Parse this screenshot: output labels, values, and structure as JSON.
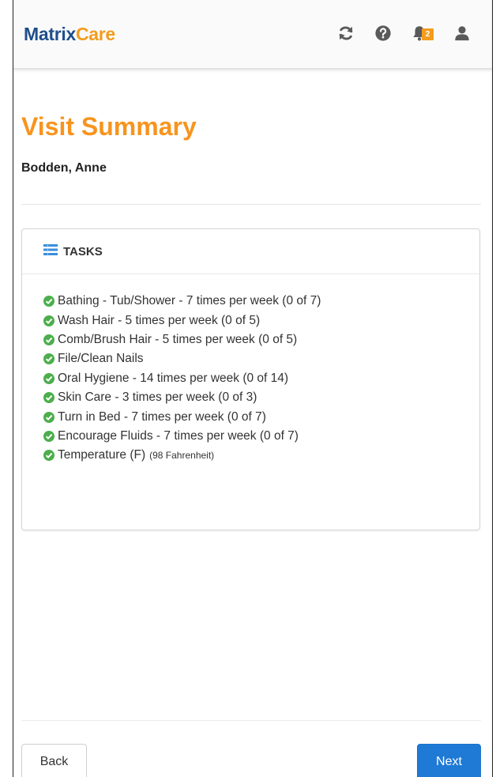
{
  "brand": {
    "part1": "Matrix",
    "part2": "Care"
  },
  "header": {
    "notification_count": "2"
  },
  "page": {
    "title": "Visit Summary",
    "patient_name": "Bodden, Anne"
  },
  "tasks_panel": {
    "title": "TASKS",
    "items": [
      {
        "label": "Bathing - Tub/Shower - 7 times per week (0 of 7)",
        "note": ""
      },
      {
        "label": "Wash Hair - 5 times per week (0 of 5)",
        "note": ""
      },
      {
        "label": "Comb/Brush Hair - 5 times per week (0 of 5)",
        "note": ""
      },
      {
        "label": "File/Clean Nails",
        "note": ""
      },
      {
        "label": "Oral Hygiene - 14 times per week (0 of 14)",
        "note": ""
      },
      {
        "label": "Skin Care - 3 times per week (0 of 3)",
        "note": ""
      },
      {
        "label": "Turn in Bed - 7 times per week (0 of 7)",
        "note": ""
      },
      {
        "label": "Encourage Fluids - 7 times per week (0 of 7)",
        "note": ""
      },
      {
        "label": "Temperature (F)",
        "note": "(98 Fahrenheit)"
      }
    ]
  },
  "footer": {
    "back_label": "Back",
    "next_label": "Next"
  },
  "colors": {
    "brand_blue": "#1f4e8c",
    "brand_orange": "#f39c1e",
    "check_green": "#4cae4c",
    "primary_button": "#1f7ad6"
  },
  "icons": [
    "refresh-icon",
    "help-icon",
    "bell-icon",
    "user-icon",
    "list-icon",
    "check-circle-icon"
  ]
}
